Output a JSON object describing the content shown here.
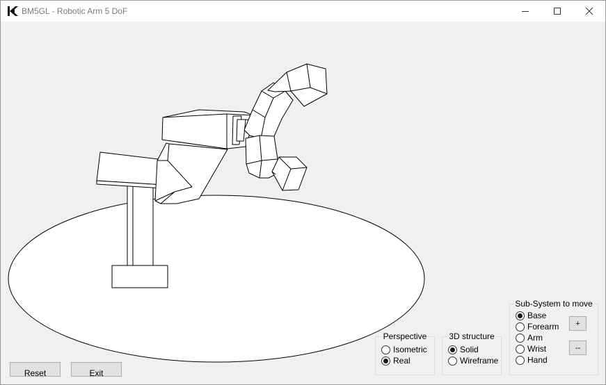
{
  "window": {
    "title": "BM5GL - Robotic Arm 5 DoF"
  },
  "perspective": {
    "title": "Perspective",
    "options": [
      {
        "label": "Isometric",
        "selected": false
      },
      {
        "label": "Real",
        "selected": true
      }
    ]
  },
  "structure": {
    "title": "3D structure",
    "options": [
      {
        "label": "Solid",
        "selected": true
      },
      {
        "label": "Wireframe",
        "selected": false
      }
    ]
  },
  "subsystem": {
    "title": "Sub-System to move",
    "options": [
      {
        "label": "Base",
        "selected": true
      },
      {
        "label": "Forearm",
        "selected": false
      },
      {
        "label": "Arm",
        "selected": false
      },
      {
        "label": "Wrist",
        "selected": false
      },
      {
        "label": "Hand",
        "selected": false
      }
    ],
    "plus_label": "+",
    "minus_label": "--"
  },
  "buttons": {
    "reset": "Reset",
    "exit": "Exit"
  }
}
